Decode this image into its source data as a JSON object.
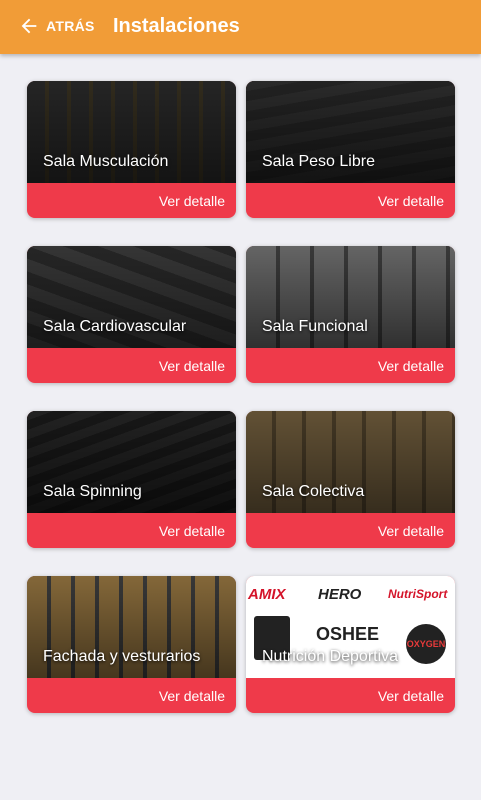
{
  "appbar": {
    "back_label": "ATRÁS",
    "title": "Instalaciones",
    "color": "#f19c37"
  },
  "cards": [
    {
      "title": "Sala Musculación",
      "action": "Ver detalle"
    },
    {
      "title": "Sala Peso Libre",
      "action": "Ver detalle"
    },
    {
      "title": "Sala Cardiovascular",
      "action": "Ver detalle"
    },
    {
      "title": "Sala Funcional",
      "action": "Ver detalle"
    },
    {
      "title": "Sala Spinning",
      "action": "Ver detalle"
    },
    {
      "title": "Sala Colectiva",
      "action": "Ver detalle"
    },
    {
      "title": "Fachada y vesturarios",
      "action": "Ver detalle"
    },
    {
      "title": "Nutrición Deportiva",
      "action": "Ver detalle"
    }
  ],
  "brand_logos": [
    "AMIX",
    "HERO",
    "NutriSport",
    "OSHEE",
    "OXYGEN"
  ],
  "colors": {
    "background": "#efeff4",
    "card_footer": "#ef3a4a"
  }
}
